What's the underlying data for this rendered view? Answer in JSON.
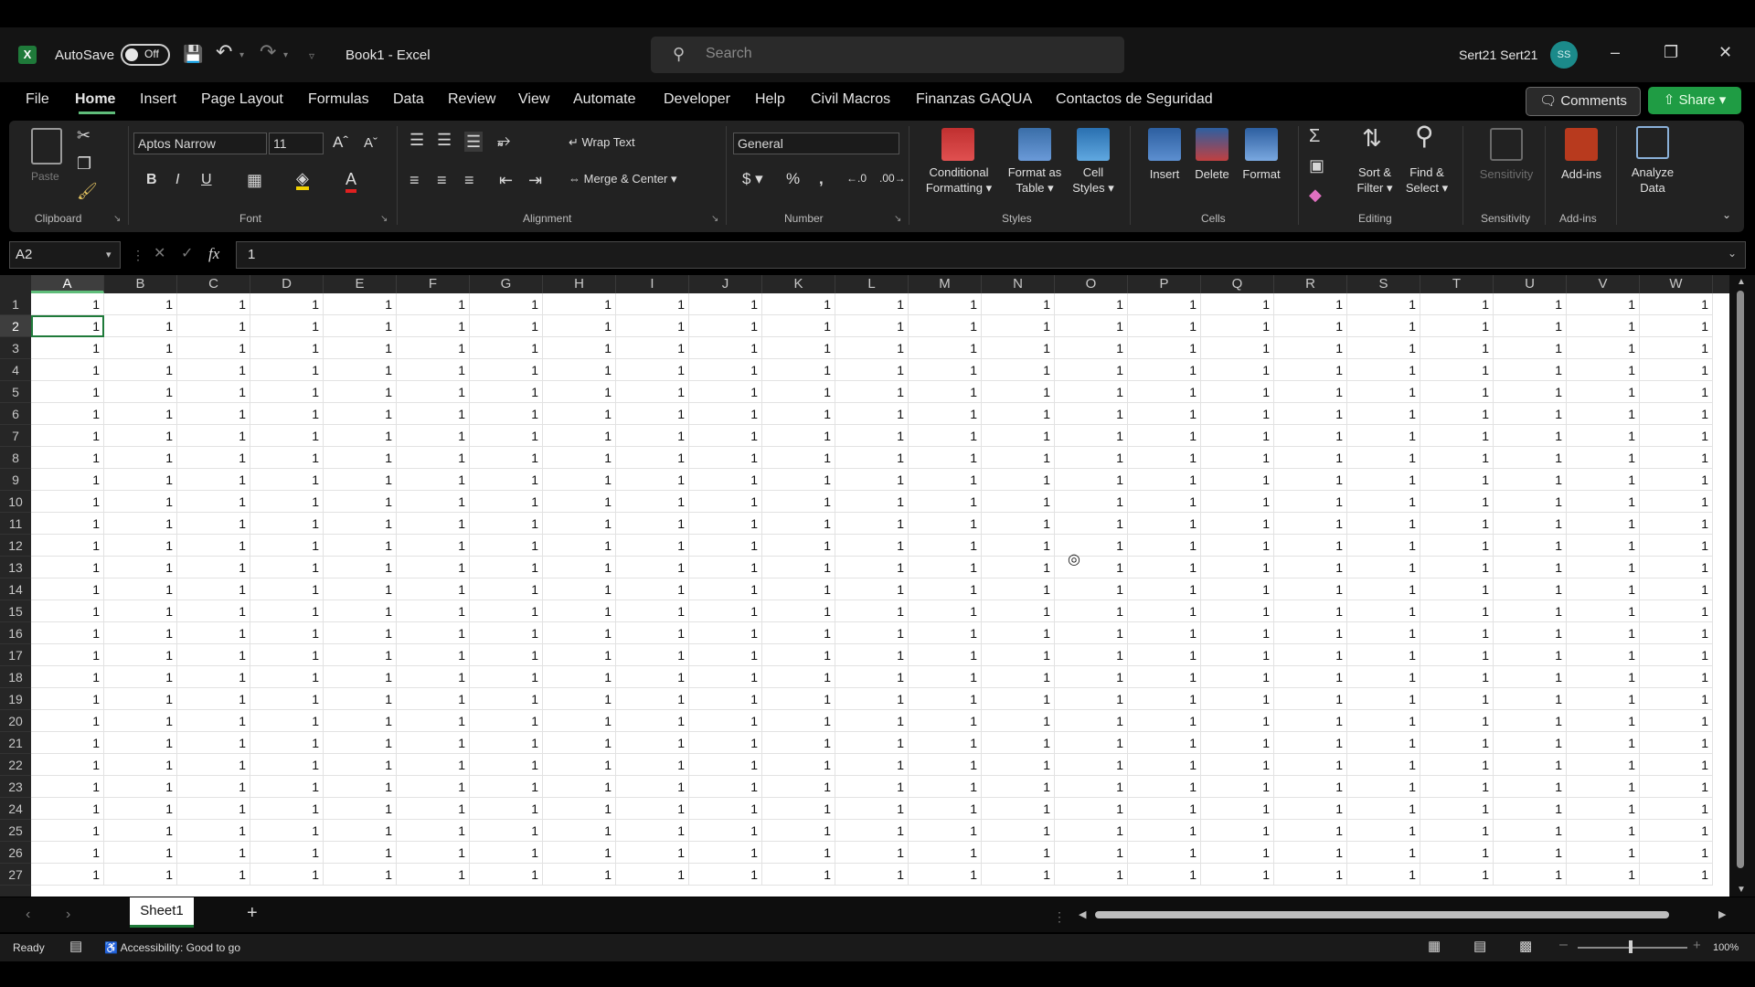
{
  "titlebar": {
    "autosave_label": "AutoSave",
    "autosave_state": "Off",
    "doc_title": "Book1 - Excel",
    "search_placeholder": "Search",
    "user_name": "Sert21 Sert21",
    "avatar_initials": "SS"
  },
  "menu": {
    "tabs": [
      "File",
      "Home",
      "Insert",
      "Page Layout",
      "Formulas",
      "Data",
      "Review",
      "View",
      "Automate",
      "Developer",
      "Help",
      "Civil Macros",
      "Finanzas GAQUA",
      "Contactos de Seguridad"
    ],
    "active": "Home",
    "comments_label": "Comments",
    "share_label": "Share"
  },
  "ribbon": {
    "clipboard": {
      "paste": "Paste",
      "label": "Clipboard"
    },
    "font": {
      "family": "Aptos Narrow",
      "size": "11",
      "label": "Font"
    },
    "alignment": {
      "wrap_text": "Wrap Text",
      "merge_center": "Merge & Center",
      "label": "Alignment"
    },
    "number": {
      "format": "General",
      "label": "Number"
    },
    "styles": {
      "conditional": "Conditional",
      "conditional2": "Formatting",
      "format_as": "Format as",
      "format_as2": "Table",
      "cell": "Cell",
      "cell2": "Styles",
      "label": "Styles"
    },
    "cells": {
      "insert": "Insert",
      "delete": "Delete",
      "format": "Format",
      "label": "Cells"
    },
    "editing": {
      "sort": "Sort &",
      "sort2": "Filter",
      "find": "Find &",
      "find2": "Select",
      "label": "Editing"
    },
    "sensitivity": {
      "btn": "Sensitivity",
      "label": "Sensitivity"
    },
    "addins": {
      "btn": "Add-ins",
      "label": "Add-ins"
    },
    "analyze": {
      "btn": "Analyze",
      "btn2": "Data"
    }
  },
  "formula_bar": {
    "name_box": "A2",
    "fx": "fx",
    "value": "1"
  },
  "grid": {
    "columns": [
      "A",
      "B",
      "C",
      "D",
      "E",
      "F",
      "G",
      "H",
      "I",
      "J",
      "K",
      "L",
      "M",
      "N",
      "O",
      "P",
      "Q",
      "R",
      "S",
      "T",
      "U",
      "V",
      "W"
    ],
    "rows": [
      "1",
      "2",
      "3",
      "4",
      "5",
      "6",
      "7",
      "8",
      "9",
      "10",
      "11",
      "12",
      "13",
      "14",
      "15",
      "16",
      "17",
      "18",
      "19",
      "20",
      "21",
      "22",
      "23",
      "24",
      "25",
      "26",
      "27"
    ],
    "cell_value": "1",
    "selected_cell": "A2"
  },
  "sheets": {
    "tabs": [
      "Sheet1"
    ],
    "add": "+"
  },
  "status": {
    "ready": "Ready",
    "accessibility": "Accessibility: Good to go",
    "zoom": "100%"
  },
  "colors": {
    "accent_green": "#1f9c44",
    "excel_green": "#1f7a3a"
  }
}
